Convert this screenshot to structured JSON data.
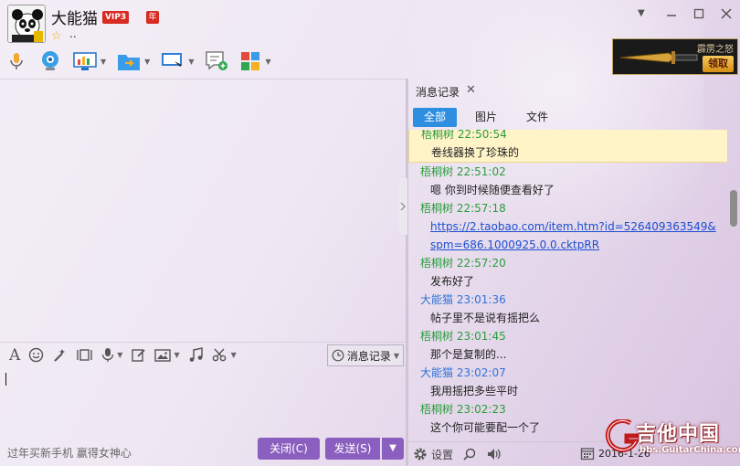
{
  "contact": {
    "nickname": "大能猫",
    "vip_badge": "VIP3",
    "year_badge": "年",
    "signature": ".."
  },
  "window_controls": [
    "minimize",
    "maximize",
    "close"
  ],
  "toolbar_icons": [
    "microphone-icon",
    "video-icon",
    "remote-desktop-icon",
    "file-transfer-icon",
    "screen-share-icon",
    "sms-icon",
    "apps-icon"
  ],
  "ad": {
    "title": "霹雳之怒",
    "claim_label": "领取"
  },
  "input_toolbar": {
    "icons": [
      "font-icon",
      "emoji-icon",
      "magic-icon",
      "screenshot-icon",
      "voice-icon",
      "edit-icon",
      "image-icon",
      "music-icon",
      "scissors-icon"
    ],
    "message_record_label": "消息记录"
  },
  "input_ad_text": "过年买新手机 赢得女神心",
  "buttons": {
    "close_label": "关闭(C)",
    "send_label": "发送(S)"
  },
  "history": {
    "tab_title": "消息记录",
    "filters": [
      "全部",
      "图片",
      "文件"
    ],
    "active_filter": "全部",
    "messages": [
      {
        "sender": "梧桐树",
        "time": "22:50:54",
        "text": "卷线器换了珍珠的",
        "color": "green",
        "highlight": true
      },
      {
        "sender": "梧桐树",
        "time": "22:51:02",
        "text": "嗯 你到时候随便查看好了",
        "color": "green"
      },
      {
        "sender": "梧桐树",
        "time": "22:57:18",
        "link1": "https://2.taobao.com/item.htm?id=526409363549&",
        "link2": "spm=686.1000925.0.0.cktpRR",
        "color": "green"
      },
      {
        "sender": "梧桐树",
        "time": "22:57:20",
        "text": "发布好了",
        "color": "green"
      },
      {
        "sender": "大能猫",
        "time": "23:01:36",
        "text": "帖子里不是说有摇把么",
        "color": "blue"
      },
      {
        "sender": "梧桐树",
        "time": "23:01:45",
        "text": "那个是复制的...",
        "color": "green"
      },
      {
        "sender": "大能猫",
        "time": "23:02:07",
        "text": "我用摇把多些平时",
        "color": "blue"
      },
      {
        "sender": "梧桐树",
        "time": "23:02:23",
        "text": "这个你可能要配一个了",
        "color": "green"
      }
    ],
    "settings_label": "设置",
    "date": "2016-1-26"
  },
  "watermark": {
    "title": "吉他中国",
    "url": "bbs.GuitarChina.com"
  },
  "colors": {
    "accent_purple": "#8b5fbf",
    "active_tab_blue": "#2e8ee0",
    "sender_green": "#2a9d3c",
    "sender_blue": "#2f73d8"
  }
}
